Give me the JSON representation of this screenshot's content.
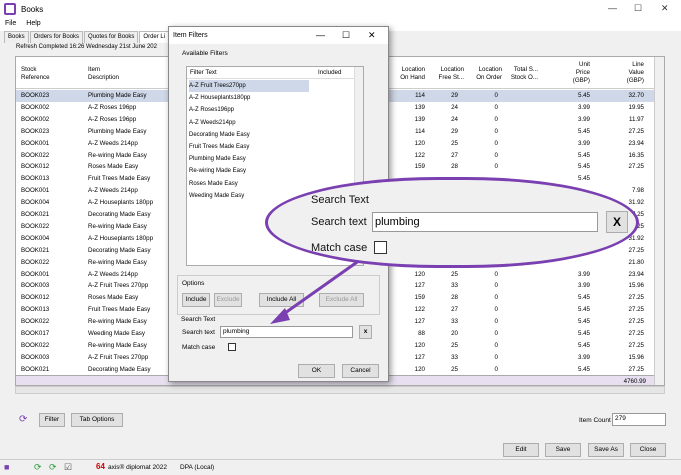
{
  "app": {
    "title": "Books"
  },
  "menu": [
    "File",
    "Help"
  ],
  "tabs": [
    "Books",
    "Orders for Books",
    "Quotes for Books",
    "Order Li"
  ],
  "status": "Refresh Completed 16:26 Wednesday 21st June 202",
  "grid": {
    "headers": {
      "stock_ref": [
        "Stock",
        "Reference"
      ],
      "item_desc": [
        "Item",
        "Description"
      ],
      "on_hand": [
        "Location",
        "On Hand"
      ],
      "free_stock": [
        "Location",
        "Free St..."
      ],
      "on_order": [
        "Location",
        "On Order"
      ],
      "total": [
        "Total S...",
        "Stock O..."
      ],
      "unit_price": [
        "Unit",
        "Price",
        "(GBP)"
      ],
      "line_value": [
        "Line",
        "Value",
        "(GBP)"
      ]
    },
    "rows": [
      {
        "ref": "BOOK023",
        "desc": "Plumbing Made Easy",
        "hand": "114",
        "free": "29",
        "order": "0",
        "price": "5.45",
        "value": "32.70"
      },
      {
        "ref": "BOOK002",
        "desc": "A-Z Roses 196pp",
        "hand": "139",
        "free": "24",
        "order": "0",
        "price": "3.99",
        "value": "19.95"
      },
      {
        "ref": "BOOK002",
        "desc": "A-Z Roses 196pp",
        "hand": "139",
        "free": "24",
        "order": "0",
        "price": "3.99",
        "value": "11.97"
      },
      {
        "ref": "BOOK023",
        "desc": "Plumbing Made Easy",
        "hand": "114",
        "free": "29",
        "order": "0",
        "price": "5.45",
        "value": "27.25"
      },
      {
        "ref": "BOOK001",
        "desc": "A-Z Weeds 214pp",
        "hand": "120",
        "free": "25",
        "order": "0",
        "price": "3.99",
        "value": "23.94"
      },
      {
        "ref": "BOOK022",
        "desc": "Re-wiring Made Easy",
        "hand": "122",
        "free": "27",
        "order": "0",
        "price": "5.45",
        "value": "16.35"
      },
      {
        "ref": "BOOK012",
        "desc": "Roses Made Easy",
        "hand": "159",
        "free": "28",
        "order": "0",
        "price": "5.45",
        "value": "27.25"
      },
      {
        "ref": "BOOK013",
        "desc": "Fruit Trees Made Easy",
        "hand": "",
        "free": "",
        "order": "",
        "price": "5.45",
        "value": ""
      },
      {
        "ref": "BOOK001",
        "desc": "A-Z Weeds 214pp",
        "hand": "",
        "free": "",
        "order": "",
        "price": "",
        "value": "7.98"
      },
      {
        "ref": "BOOK004",
        "desc": "A-Z Houseplants 180pp",
        "hand": "",
        "free": "",
        "order": "",
        "price": "",
        "value": "31.92"
      },
      {
        "ref": "BOOK021",
        "desc": "Decorating Made Easy",
        "hand": "",
        "free": "",
        "order": "",
        "price": "",
        "value": "27.25"
      },
      {
        "ref": "BOOK022",
        "desc": "Re-wiring Made Easy",
        "hand": "",
        "free": "",
        "order": "",
        "price": "",
        "value": "27.25"
      },
      {
        "ref": "BOOK004",
        "desc": "A-Z Houseplants 180pp",
        "hand": "",
        "free": "",
        "order": "",
        "price": "",
        "value": "31.92"
      },
      {
        "ref": "BOOK021",
        "desc": "Decorating Made Easy",
        "hand": "",
        "free": "",
        "order": "",
        "price": "",
        "value": "27.25"
      },
      {
        "ref": "BOOK022",
        "desc": "Re-wiring Made Easy",
        "hand": "",
        "free": "",
        "order": "",
        "price": "",
        "value": "21.80"
      },
      {
        "ref": "BOOK001",
        "desc": "A-Z Weeds 214pp",
        "hand": "120",
        "free": "25",
        "order": "0",
        "price": "3.99",
        "value": "23.94"
      },
      {
        "ref": "BOOK003",
        "desc": "A-Z Fruit Trees 270pp",
        "hand": "127",
        "free": "33",
        "order": "0",
        "price": "3.99",
        "value": "15.96"
      },
      {
        "ref": "BOOK012",
        "desc": "Roses Made Easy",
        "hand": "159",
        "free": "28",
        "order": "0",
        "price": "5.45",
        "value": "27.25"
      },
      {
        "ref": "BOOK013",
        "desc": "Fruit Trees Made Easy",
        "hand": "122",
        "free": "27",
        "order": "0",
        "price": "5.45",
        "value": "27.25"
      },
      {
        "ref": "BOOK022",
        "desc": "Re-wiring Made Easy",
        "hand": "127",
        "free": "33",
        "order": "0",
        "price": "5.45",
        "value": "27.25"
      },
      {
        "ref": "BOOK017",
        "desc": "Weeding Made Easy",
        "hand": "88",
        "free": "20",
        "order": "0",
        "price": "5.45",
        "value": "27.25"
      },
      {
        "ref": "BOOK022",
        "desc": "Re-wiring Made Easy",
        "hand": "120",
        "free": "25",
        "order": "0",
        "price": "5.45",
        "value": "27.25"
      },
      {
        "ref": "BOOK003",
        "desc": "A-Z Fruit Trees 270pp",
        "hand": "127",
        "free": "33",
        "order": "0",
        "price": "3.99",
        "value": "15.96"
      },
      {
        "ref": "BOOK021",
        "desc": "Decorating Made Easy",
        "hand": "120",
        "free": "25",
        "order": "0",
        "price": "5.45",
        "value": "27.25"
      }
    ],
    "total": "4760.99"
  },
  "bottom": {
    "filter": "Filter",
    "tab_options": "Tab Options",
    "item_count_label": "Item Count",
    "item_count": "279"
  },
  "footer_buttons": {
    "edit": "Edit",
    "save": "Save",
    "save_as": "Save As",
    "close": "Close"
  },
  "statusbar": {
    "product": "axis® diplomat 2022",
    "db": "DPA (Local)"
  },
  "dialog": {
    "title": "Item Filters",
    "available_filters": "Available Filters",
    "col_filter_text": "Filter Text",
    "col_included": "Included",
    "filters": [
      "A-Z Fruit Trees270pp",
      "A-Z Houseplants180pp",
      "A-Z Roses196pp",
      "A-Z Weeds214pp",
      "Decorating Made Easy",
      "Fruit Trees Made Easy",
      "Plumbing Made Easy",
      "Re-wiring Made Easy",
      "Roses Made Easy",
      "Weeding Made Easy"
    ],
    "options": "Options",
    "include": "Include",
    "exclude": "Exclude",
    "include_all": "Include All",
    "exclude_all": "Exclude All",
    "search_text_group": "Search Text",
    "search_text_label": "Search text",
    "search_value": "plumbing",
    "clear": "x",
    "match_case": "Match case",
    "ok": "OK",
    "cancel": "Cancel"
  },
  "callout": {
    "group": "Search Text",
    "label": "Search text",
    "value": "plumbing",
    "clear": "X",
    "match_case": "Match case"
  },
  "colors": {
    "accent": "#7a3fb0",
    "selection": "#cfd8e8"
  }
}
